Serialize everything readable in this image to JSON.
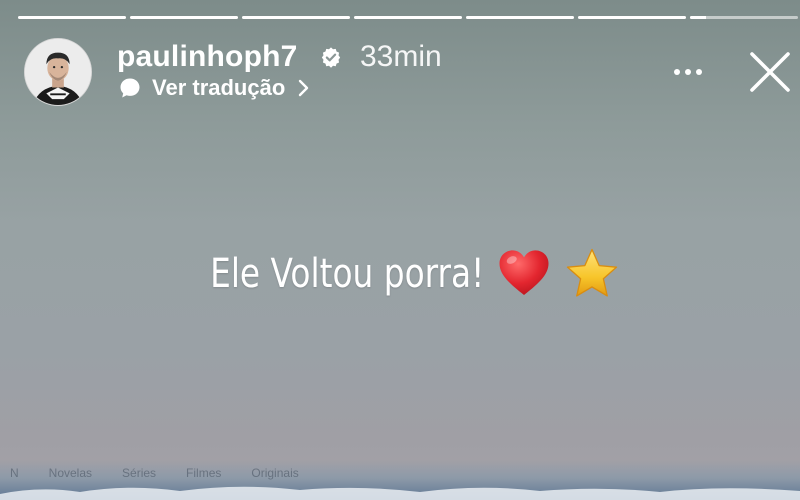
{
  "story": {
    "progress": {
      "segment_count": 7,
      "filled_fractions": [
        1,
        1,
        1,
        1,
        1,
        1,
        0.15
      ]
    },
    "header": {
      "username": "paulinhoph7",
      "verified": true,
      "time_ago": "33min",
      "translate_label": "Ver tradução",
      "avatar_icon": "profile-photo",
      "more_icon": "more-horizontal-icon",
      "close_icon": "close-icon"
    },
    "caption": {
      "text": "Ele Voltou porra!",
      "emojis": [
        "red-heart",
        "star"
      ]
    },
    "bottom_peek": {
      "menu_items": [
        "N",
        "Novelas",
        "Séries",
        "Filmes",
        "Originais"
      ]
    }
  },
  "colors": {
    "text": "#ffffff",
    "verified_badge": "#ffffff",
    "heart": "#e3262f",
    "star": "#f7c52a"
  }
}
